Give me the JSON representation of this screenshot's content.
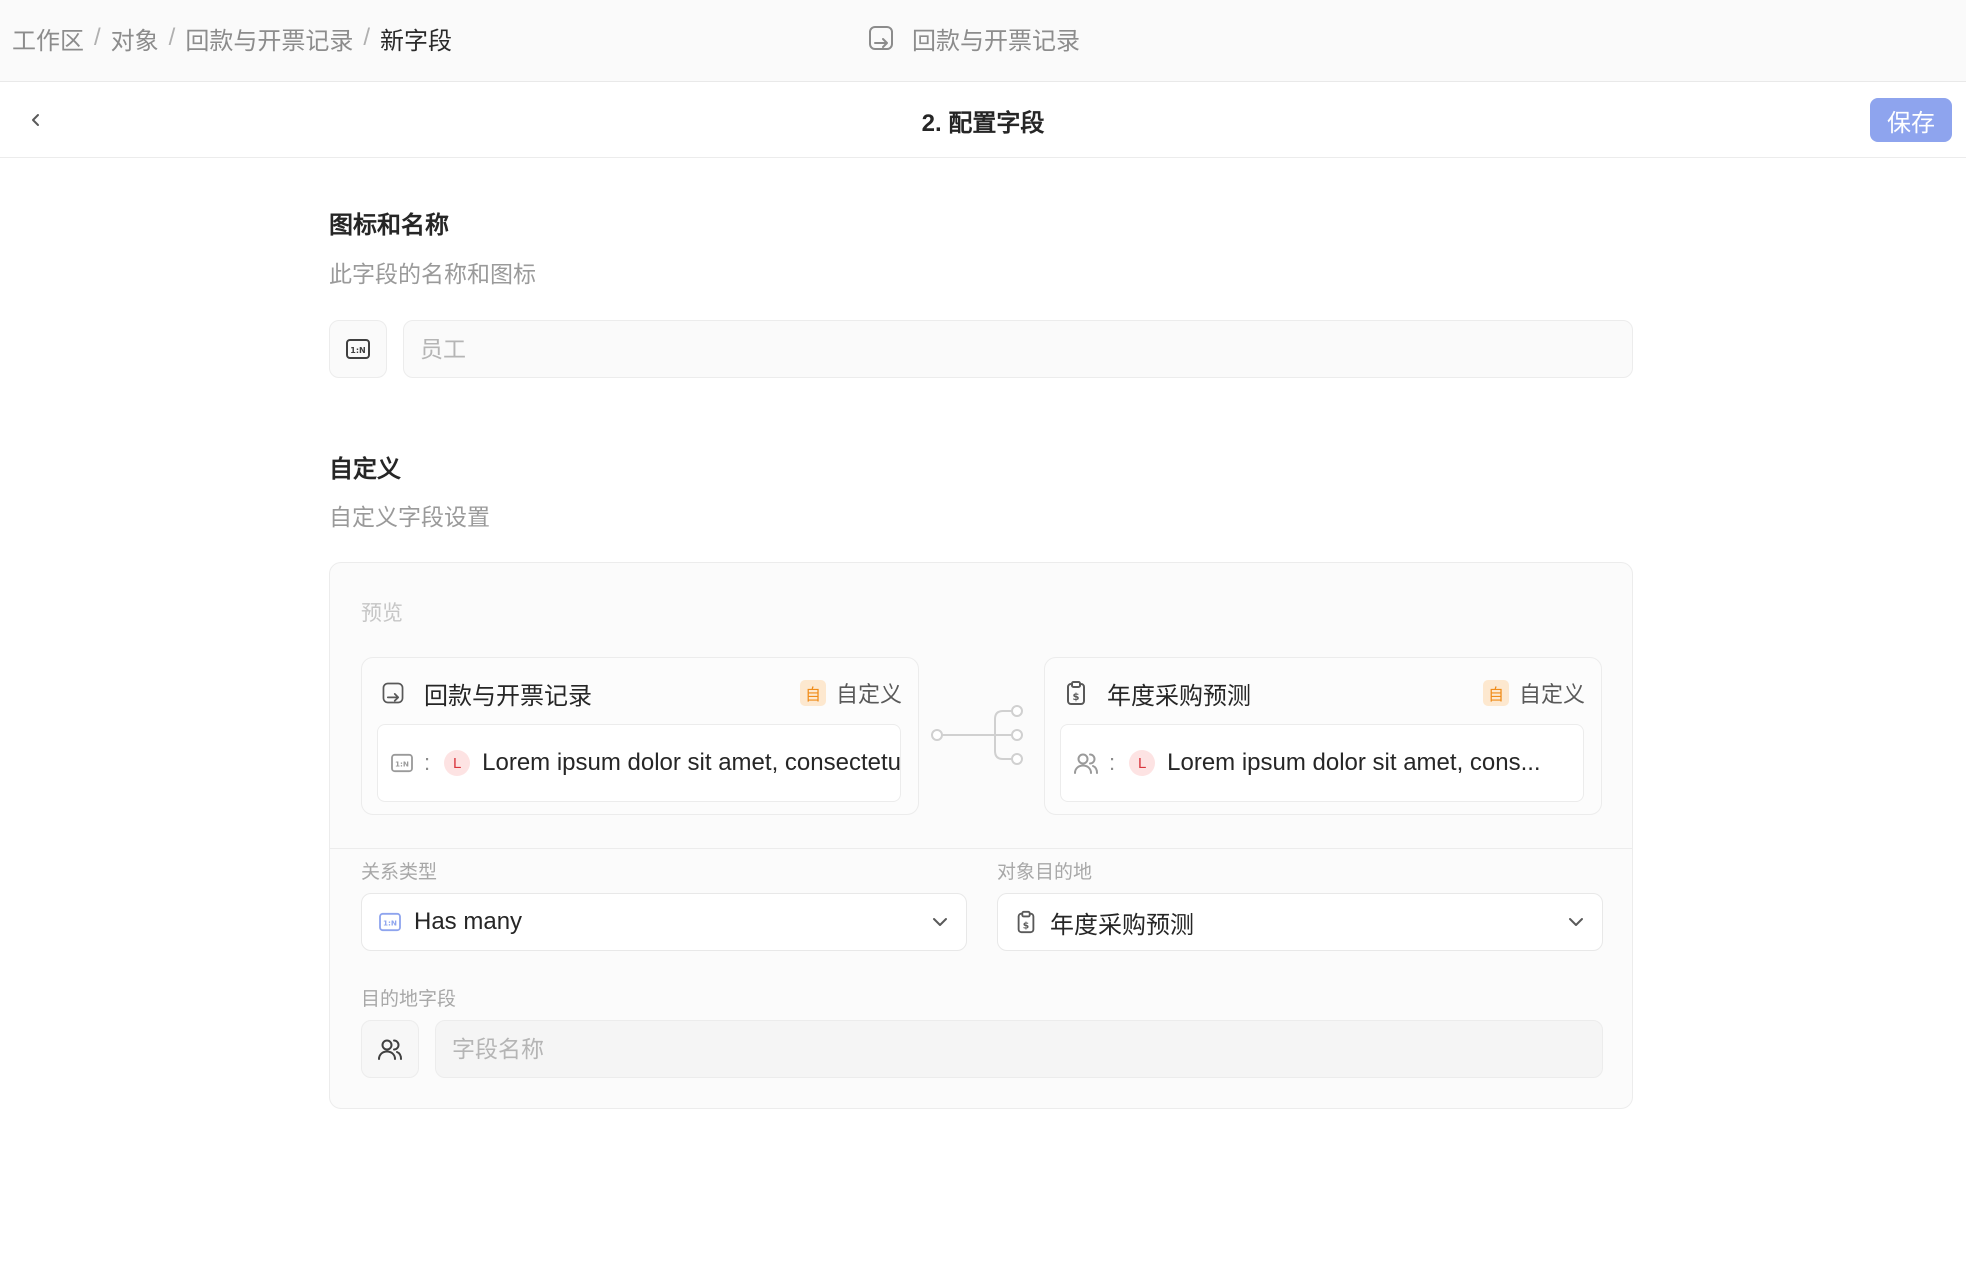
{
  "breadcrumb": {
    "items": [
      "工作区",
      "对象",
      "回款与开票记录"
    ],
    "separator": "/",
    "current": "新字段"
  },
  "header_object": {
    "icon": "object-record-icon",
    "title": "回款与开票记录"
  },
  "step": {
    "title": "2. 配置字段",
    "save_label": "保存",
    "back_icon": "chevron-left-icon"
  },
  "icon_name_section": {
    "title": "图标和名称",
    "description": "此字段的名称和图标",
    "icon": "relation-1n-icon",
    "name_value": "",
    "name_placeholder": "员工"
  },
  "custom_section": {
    "title": "自定义",
    "description": "自定义字段设置"
  },
  "preview": {
    "label": "预览",
    "source_card": {
      "icon": "object-record-icon",
      "title": "回款与开票记录",
      "badge": "自",
      "badge_text": "自定义",
      "row_icon": "relation-1n-icon",
      "row_separator": ":",
      "row_avatar": "L",
      "row_text": "Lorem ipsum dolor sit amet, consectetur"
    },
    "target_card": {
      "icon": "clipboard-dollar-icon",
      "title": "年度采购预测",
      "badge": "自",
      "badge_text": "自定义",
      "row_icon": "users-icon",
      "row_separator": ":",
      "row_avatar": "L",
      "row_text": "Lorem ipsum dolor sit amet, cons..."
    }
  },
  "relation": {
    "type_label": "关系类型",
    "type_icon": "relation-1n-icon",
    "type_value": "Has many",
    "destination_label": "对象目的地",
    "destination_icon": "clipboard-dollar-icon",
    "destination_value": "年度采购预测",
    "dest_field_label": "目的地字段",
    "dest_field_icon": "users-icon",
    "dest_field_value": "",
    "dest_field_placeholder": "字段名称"
  },
  "colors": {
    "accent": "#8ea4ee",
    "badge_bg": "#fde8cf",
    "badge_fg": "#f08c1a",
    "avatar_bg": "#fde3e3",
    "avatar_fg": "#d9363e"
  }
}
